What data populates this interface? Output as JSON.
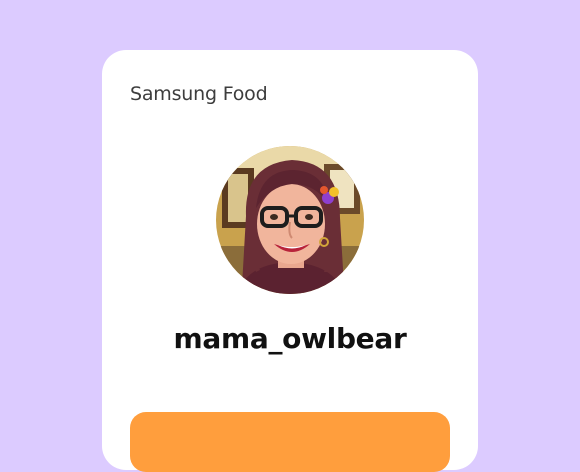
{
  "brand": {
    "name": "Samsung Food"
  },
  "profile": {
    "username": "mama_owlbear",
    "avatar_icon": "profile-photo"
  },
  "colors": {
    "page_background": "#dccbff",
    "card_background": "#ffffff",
    "cta_background": "#ff9e3d"
  }
}
